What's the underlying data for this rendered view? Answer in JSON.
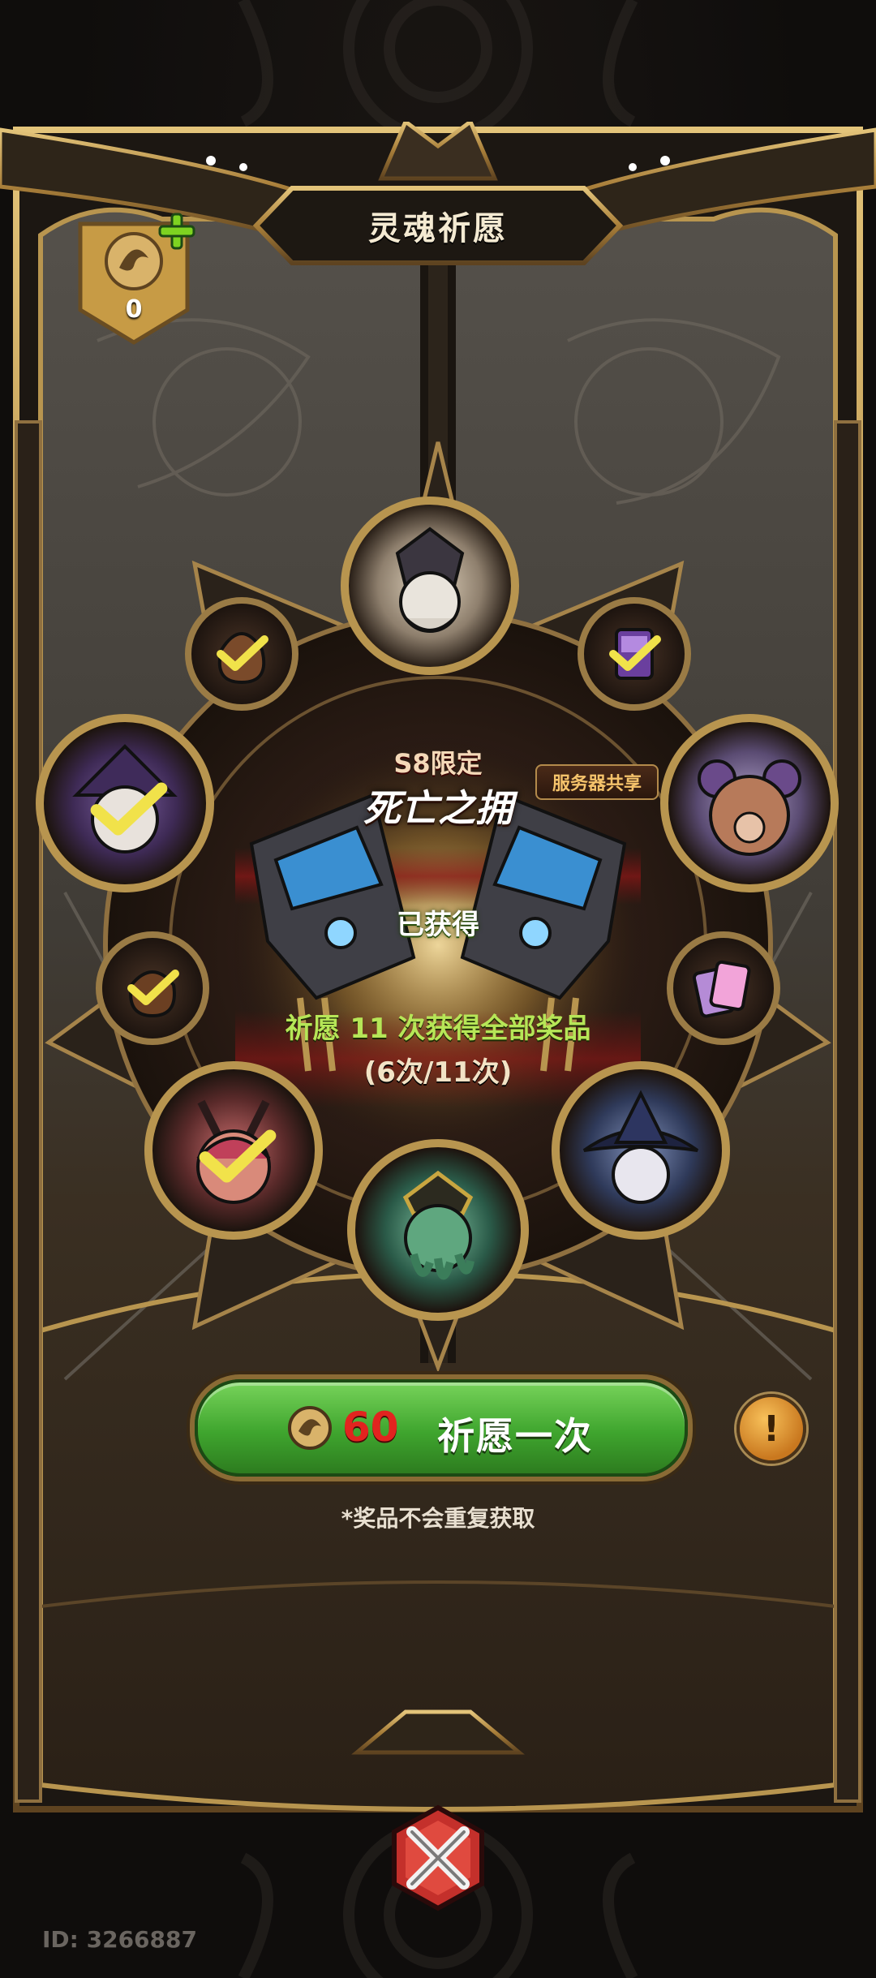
{
  "panel": {
    "title": "灵魂祈愿"
  },
  "currency": {
    "count": "0",
    "icon": "soul-coin-icon",
    "add_icon": "plus-icon"
  },
  "featured": {
    "season_label": "S8限定",
    "name": "死亡之拥",
    "server_tag": "服务器共享",
    "status": "已获得"
  },
  "progress": {
    "text": "祈愿 11 次获得全部奖品",
    "count": "(6次/11次)",
    "done": 6,
    "total": 11
  },
  "rewards": [
    {
      "name": "reward-top-hero",
      "icon": "horned-knight-hero-icon",
      "obtained": false
    },
    {
      "name": "reward-upper-left-small",
      "icon": "pouch-icon",
      "obtained": true
    },
    {
      "name": "reward-upper-right-small",
      "icon": "purple-card-icon",
      "obtained": true
    },
    {
      "name": "reward-left-hero",
      "icon": "witch-hero-icon",
      "obtained": true
    },
    {
      "name": "reward-right-hero",
      "icon": "bear-hero-icon",
      "obtained": false
    },
    {
      "name": "reward-mid-left-small",
      "icon": "bag-icon",
      "obtained": true
    },
    {
      "name": "reward-mid-right-small",
      "icon": "card-pack-icon",
      "obtained": false
    },
    {
      "name": "reward-lower-left-hero",
      "icon": "horned-girl-hero-icon",
      "obtained": true
    },
    {
      "name": "reward-lower-right-hero",
      "icon": "wizard-hero-icon",
      "obtained": false
    },
    {
      "name": "reward-bottom-hero",
      "icon": "tentacle-hero-icon",
      "obtained": false
    }
  ],
  "wish_button": {
    "cost": "60",
    "label": "祈愿一次",
    "cost_color": "#e2241f"
  },
  "info_button": {
    "glyph": "!"
  },
  "note": "*奖品不会重复获取",
  "close_icon": "close-x-icon",
  "player_id": "ID: 3266887",
  "colors": {
    "gold": "#b8954f",
    "green_button": "#3fa52e",
    "progress_green": "#b6e657"
  }
}
